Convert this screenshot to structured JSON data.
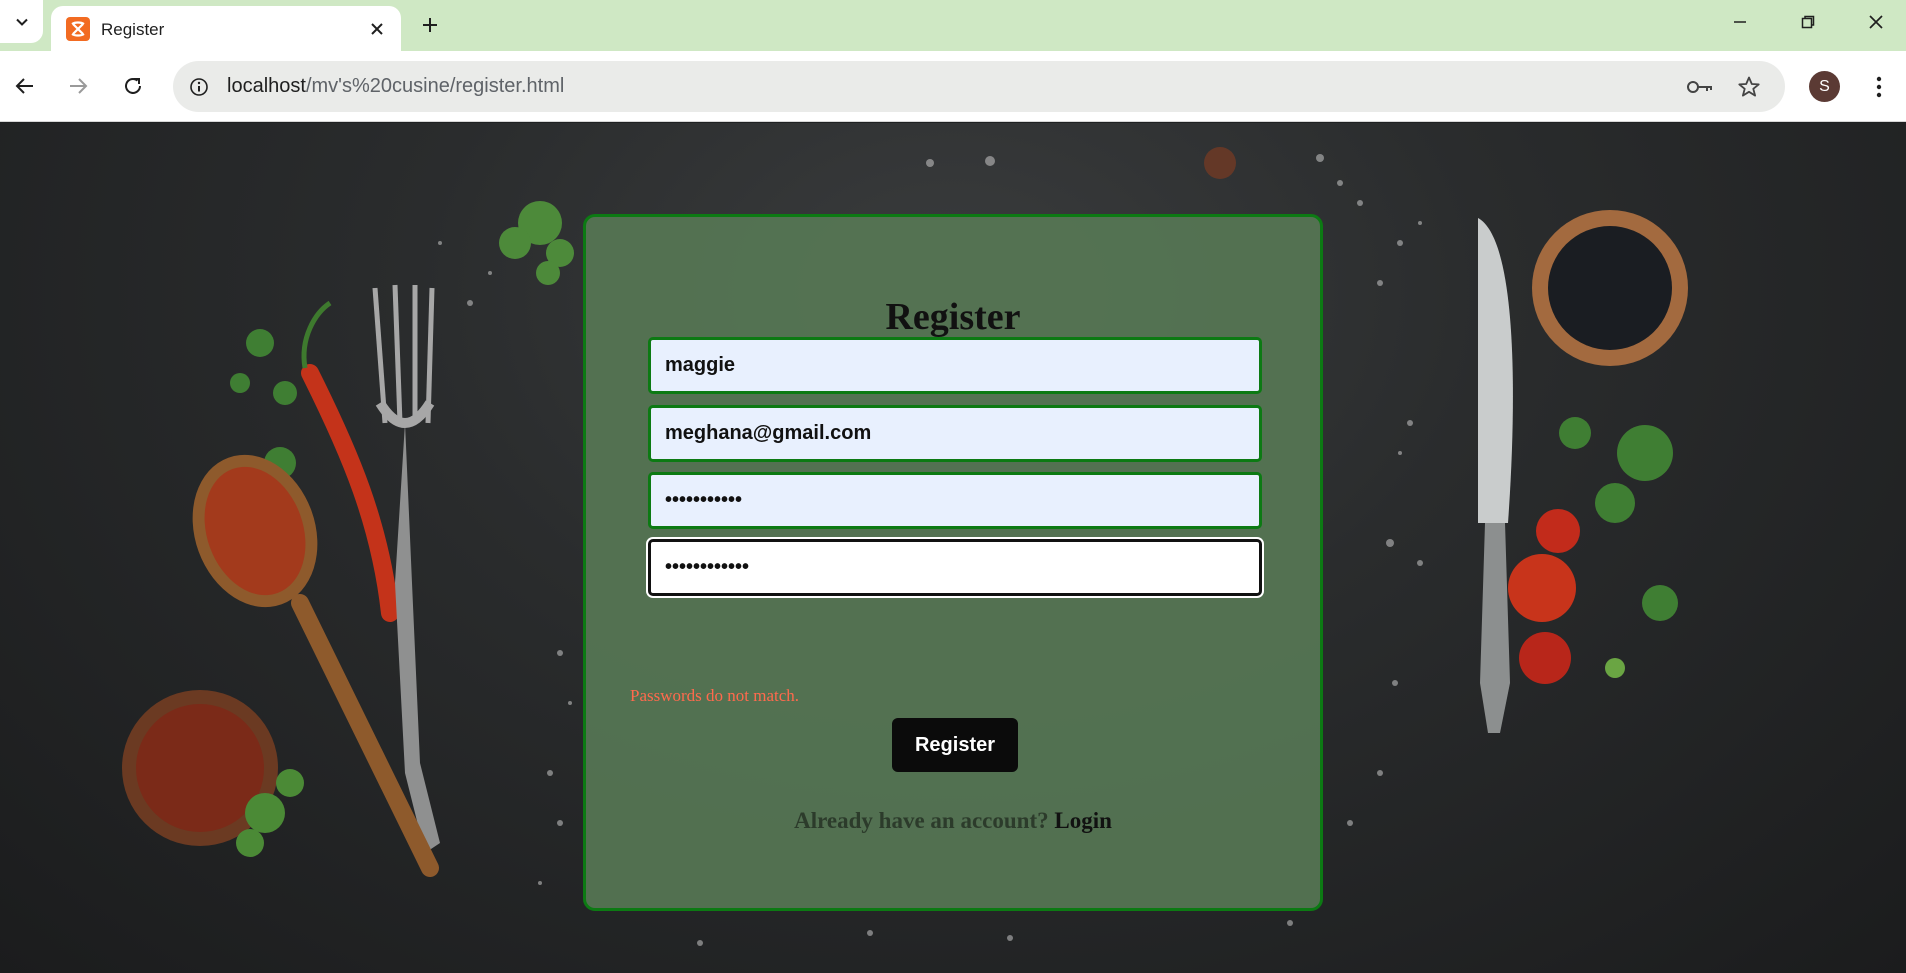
{
  "browser": {
    "tab_title": "Register",
    "url_host": "localhost",
    "url_path": "/mv's%20cusine/register.html",
    "profile_initial": "S"
  },
  "form": {
    "heading": "Register",
    "username_value": "maggie",
    "email_value": "meghana@gmail.com",
    "password_value": "•••••••••••",
    "confirm_password_value": "••••••••••••",
    "error_message": "Passwords do not match.",
    "submit_label": "Register",
    "footer_text": "Already have an account?",
    "login_link": "Login"
  },
  "colors": {
    "card_bg": "#567654",
    "card_border": "#0c7a13",
    "error_text": "#ff6a4d",
    "button_bg": "#0b0b0b",
    "tabstrip_bg": "#cfe8c4"
  }
}
